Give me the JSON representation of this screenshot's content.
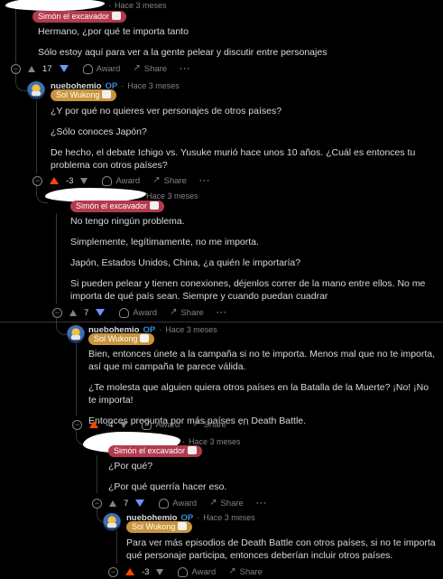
{
  "comments": [
    {
      "author": "",
      "time": "Hace 3 meses",
      "flair": "Simón el excavador",
      "paragraphs": [
        "Hermano, ¿por qué te importa tanto",
        "Sólo estoy aquí para ver a la gente pelear y discutir entre personajes"
      ],
      "score": "17",
      "vote": "down",
      "award": "Award",
      "share": "Share",
      "more": "···"
    },
    {
      "author": "nuebohemio",
      "op": "OP",
      "time": "Hace 3 meses",
      "flair": "Sol Wukong",
      "paragraphs": [
        "¿Y por qué no quieres ver personajes de otros países?",
        "¿Sólo conoces Japón?",
        "De hecho, el debate Ichigo vs. Yusuke murió hace unos 10 años. ¿Cuál es entonces tu problema con otros países?"
      ],
      "score": "-3",
      "vote": "up",
      "award": "Award",
      "share": "Share",
      "more": "···"
    },
    {
      "author": "",
      "time": "Hace 3 meses",
      "flair": "Simón el excavador",
      "paragraphs": [
        "No tengo ningún problema.",
        "Simplemente, legítimamente, no me importa.",
        "Japón, Estados Unidos, China, ¿a quién le importaría?",
        "Si pueden pelear y tienen conexiones, déjenlos correr de la mano entre ellos. No me importa de qué país sean. Siempre y cuando puedan cuadrar"
      ],
      "score": "7",
      "vote": "down",
      "award": "Award",
      "share": "Share",
      "more": "···"
    },
    {
      "author": "nuebohemio",
      "op": "OP",
      "time": "Hace 3 meses",
      "flair": "Sol Wukong",
      "paragraphs": [
        "Bien, entonces únete a la campaña si no te importa. Menos mal que no te importa, así que mi campaña te parece válida.",
        "¿Te molesta que alguien quiera otros países en la Batalla de la Muerte? ¡No! ¡No te importa!",
        "Entonces pregunta por más países en Death Battle."
      ],
      "score": "-4",
      "vote": "up",
      "award": "Award",
      "share": "Share",
      "more": "···"
    },
    {
      "author": "",
      "time": "Hace 3 meses",
      "flair": "Simón el excavador",
      "paragraphs": [
        "¿Por qué?",
        "¿Por qué querría hacer eso."
      ],
      "score": "7",
      "vote": "down",
      "award": "Award",
      "share": "Share",
      "more": "···"
    },
    {
      "author": "nuebohemio",
      "op": "OP",
      "time": "Hace 3 meses",
      "flair": "Sol Wukong",
      "paragraphs": [
        "Para ver más episodios de Death Battle con otros países, si no te importa qué personaje participa, entonces deberían incluir otros países."
      ],
      "score": "-3",
      "vote": "up",
      "award": "Award",
      "share": "Share"
    }
  ],
  "colors": {
    "background": "#000000",
    "text": "#d7dadc",
    "muted": "#818384",
    "upvote": "#ff4500",
    "downvote": "#7193ff",
    "op": "#3a8be0",
    "flair_red": "#b33a4e",
    "flair_gold": "#c9953c"
  }
}
